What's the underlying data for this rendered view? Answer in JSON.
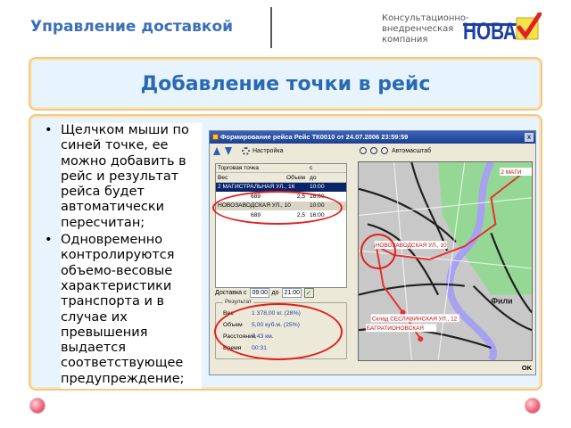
{
  "header": {
    "title": "Управление доставкой",
    "company_lines": [
      "Консультационно-",
      "внедренческая",
      "компания"
    ],
    "logo_text": "НОВА",
    "accent": "#2a6ab4"
  },
  "slide": {
    "title": "Добавление точки в рейс",
    "bullets": [
      "Щелчком мыши по синей точке, ее можно добавить в рейс и результат рейса будет автоматически пересчитан;",
      "Одновременно контролируются объемо-весовые характеристики транспорта и в случае их превышения выдается соответствующее предупреждение;"
    ]
  },
  "app": {
    "window_title": "Формирование рейса Рейс ТК0010 от 24.07.2006 23:59:59",
    "close_label": "x",
    "toolbar": {
      "settings_label": "Настройка",
      "autoscale_label": "Автомасштаб"
    },
    "grid": {
      "headers": [
        [
          "Торговая точка",
          "",
          "с"
        ],
        [
          "Вес",
          "Объем",
          "до"
        ]
      ],
      "rows": [
        [
          "2 МАГИСТРАЛЬНАЯ УЛ., 16",
          "",
          "10:00"
        ],
        [
          "689",
          "2,5",
          "16:00"
        ],
        [
          "НОВОЗАВОДСКАЯ УЛ., 10",
          "",
          "10:00"
        ],
        [
          "689",
          "2,5",
          "16:00"
        ]
      ]
    },
    "delivery": {
      "label": "Доставка с",
      "from": "09:00",
      "to_label": "до",
      "to": "21:00",
      "check": "✓"
    },
    "result": {
      "legend": "Результат",
      "rows": [
        {
          "label": "Вес",
          "value": "1 378,00 кг. (28%)"
        },
        {
          "label": "Объем",
          "value": "5,00 куб.м. (25%)"
        },
        {
          "label": "Расстояние",
          "value": "7,43 км."
        },
        {
          "label": "Время",
          "value": "00:31"
        }
      ]
    },
    "map": {
      "labels": {
        "top": "2 МАГИ",
        "mid": "НОВОЗАВОДСКАЯ УЛ., 10",
        "fili": "Фили",
        "stock": "Склад  СЕСЛАВИНСКАЯ УЛ., 12",
        "bottom": "БАГРАТИОНОВСКАЯ"
      },
      "colors": {
        "park": "#8fd98f",
        "river": "#a8a0f0",
        "route": "#e83030",
        "rail": "#202020"
      }
    },
    "ok_label": "OK"
  }
}
